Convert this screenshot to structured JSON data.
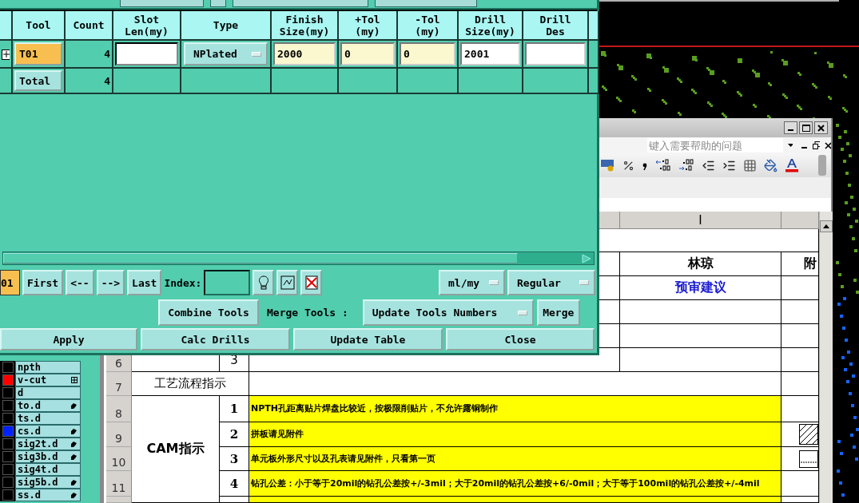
{
  "drill_dialog": {
    "columns": [
      "Tool",
      "Count",
      "Slot\nLen(my)",
      "Type",
      "Finish\nSize(my)",
      "+Tol\n(my)",
      "-Tol\n(my)",
      "Drill\nSize(my)",
      "Drill\nDes"
    ],
    "tools": [
      {
        "tool": "T01",
        "selected": true,
        "count": "4",
        "type": "NPlated",
        "finish_size": "2000",
        "plus_tol": "0",
        "minus_tol": "0",
        "drill_size": "2001"
      }
    ],
    "total": {
      "label": "Total",
      "count": "4"
    },
    "current_tool": "01",
    "nav_buttons": [
      "First",
      "<--",
      "-->",
      "Last"
    ],
    "index_label": "Index:",
    "unit_menu": "ml/my",
    "mode_menu": "Regular",
    "combine_button": "Combine Tools",
    "merge_label": "Merge Tools :",
    "merge_menu": "Update Tools Numbers",
    "merge_button": "Merge",
    "actions": [
      "Apply",
      "Calc Drills",
      "Update Table",
      "Close"
    ]
  },
  "layers": [
    {
      "name": "npth",
      "color": "#000000",
      "flagged": false,
      "expandable": false
    },
    {
      "name": "v-cut",
      "color": "#ff0000",
      "flagged": false,
      "expandable": true
    },
    {
      "name": "d",
      "color": "#000000",
      "flagged": false,
      "expandable": false
    },
    {
      "name": "to.d",
      "color": "#000000",
      "flagged": true,
      "expandable": false
    },
    {
      "name": "ts.d",
      "color": "#000000",
      "flagged": false,
      "expandable": false
    },
    {
      "name": "cs.d",
      "color": "#0022ff",
      "flagged": true,
      "expandable": false
    },
    {
      "name": "sig2t.d",
      "color": "#000000",
      "flagged": true,
      "expandable": false
    },
    {
      "name": "sig3b.d",
      "color": "#000000",
      "flagged": true,
      "expandable": false
    },
    {
      "name": "sig4t.d",
      "color": "#000000",
      "flagged": false,
      "expandable": false
    },
    {
      "name": "sig5b.d",
      "color": "#000000",
      "flagged": true,
      "expandable": false
    },
    {
      "name": "ss.d",
      "color": "#000000",
      "flagged": true,
      "expandable": false
    }
  ],
  "spreadsheet": {
    "help_placeholder": "键入需要帮助的问题",
    "column_header": "I",
    "reviewer": "林琼",
    "attachment_header": "附",
    "review_label": "预审建议",
    "process_row": {
      "number": "6",
      "seq": "3"
    },
    "flow_row": {
      "number": "7",
      "title": "工艺流程指示"
    },
    "group_title": "CAM指示",
    "rows": [
      {
        "number": "8",
        "seq": "1",
        "kind": "plain",
        "note": "NPTH孔距离贴片焊盘比较近，按极限削贴片，不允许露铜制作"
      },
      {
        "number": "9",
        "seq": "2",
        "kind": "hatched",
        "note": "拼板请见附件"
      },
      {
        "number": "10",
        "seq": "3",
        "kind": "table",
        "note": "单元板外形尺寸以及孔表请见附件，只看第一页"
      },
      {
        "number": "11",
        "seq": "4",
        "kind": "plain",
        "note": "钻孔公差：小于等于20mil的钻孔公差按+/-3mil；大于20mil的钻孔公差按+6/-0mil；大于等于100mil的钻孔公差按+/-4mil"
      }
    ]
  }
}
